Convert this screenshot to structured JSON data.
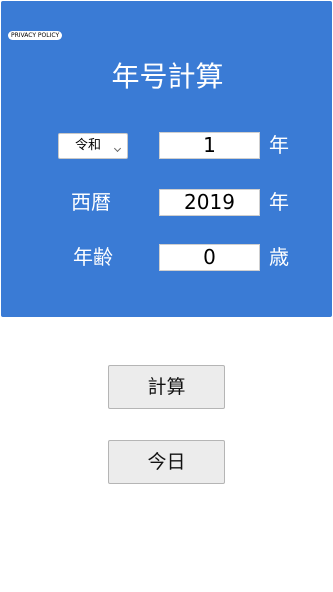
{
  "privacy_policy": "PRIVACY POLICY",
  "title": "年号計算",
  "era": {
    "selected": "令和",
    "value": "1",
    "unit": "年"
  },
  "western": {
    "label": "西暦",
    "value": "2019",
    "unit": "年"
  },
  "age": {
    "label": "年齢",
    "value": "0",
    "unit": "歳"
  },
  "buttons": {
    "calculate": "計算",
    "today": "今日"
  },
  "colors": {
    "panel": "#3a7bd5",
    "button": "#ececec"
  }
}
